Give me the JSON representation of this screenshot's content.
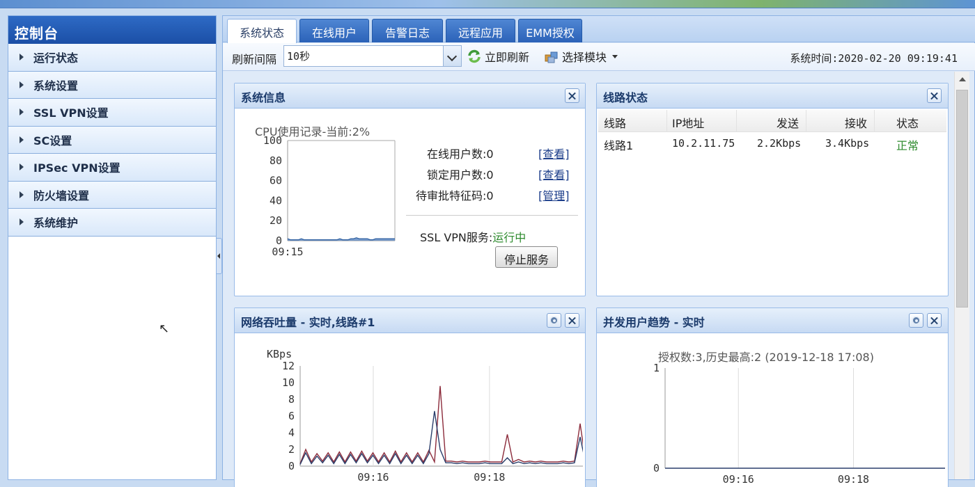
{
  "sidebar": {
    "title": "控制台",
    "items": [
      {
        "label": "运行状态"
      },
      {
        "label": "系统设置"
      },
      {
        "label": "SSL VPN设置"
      },
      {
        "label": "SC设置"
      },
      {
        "label": "IPSec VPN设置"
      },
      {
        "label": "防火墙设置"
      },
      {
        "label": "系统维护"
      }
    ]
  },
  "tabs": [
    {
      "label": "系统状态",
      "active": true
    },
    {
      "label": "在线用户"
    },
    {
      "label": "告警日志"
    },
    {
      "label": "远程应用"
    },
    {
      "label": "EMM授权"
    }
  ],
  "toolbar": {
    "interval_label": "刷新间隔",
    "interval_value": "10秒",
    "refresh_label": "立即刷新",
    "module_label": "选择模块",
    "system_time": "系统时间:2020-02-20 09:19:41"
  },
  "system_info": {
    "title": "系统信息",
    "cpu_title": "CPU使用记录-当前:2%",
    "online_users": "在线用户数:0",
    "online_link": "[查看]",
    "locked_users": "锁定用户数:0",
    "locked_link": "[查看]",
    "pending_codes": "待审批特征码:0",
    "pending_link": "[管理]",
    "service_label": "SSL VPN服务:",
    "service_status": "运行中",
    "stop_button": "停止服务"
  },
  "line_status": {
    "title": "线路状态",
    "headers": [
      "线路",
      "IP地址",
      "发送",
      "接收",
      "状态"
    ],
    "rows": [
      {
        "line": "线路1",
        "ip": "10.2.11.75",
        "send": "2.2Kbps",
        "recv": "3.4Kbps",
        "status": "正常"
      }
    ]
  },
  "throughput": {
    "title": "网络吞吐量 - 实时,线路#1"
  },
  "concurrent": {
    "title": "并发用户趋势 - 实时",
    "subtitle": "授权数:3,历史最高:2 (2019-12-18 17:08)"
  },
  "chart_data": [
    {
      "type": "area",
      "title": "CPU使用记录-当前:2%",
      "ylim": [
        0,
        100
      ],
      "yticks": [
        "100",
        "80",
        "60",
        "40",
        "20",
        "0"
      ],
      "xticks": [
        "09:15"
      ],
      "series": [
        {
          "values": [
            2,
            1,
            1,
            1,
            1,
            2,
            1,
            1,
            1,
            1,
            1,
            1,
            1,
            1,
            1,
            1,
            1,
            1,
            1,
            2,
            1,
            1,
            1,
            2,
            2,
            3,
            2,
            2,
            2,
            2,
            1,
            1,
            2,
            2,
            2,
            2,
            2,
            2,
            2,
            2
          ]
        }
      ],
      "colors": {
        "line": "#2f5f9f",
        "fill": "#5a86c2"
      }
    },
    {
      "type": "line",
      "ylabel": "KBps",
      "ylim": [
        0,
        12
      ],
      "yticks": [
        "12",
        "10",
        "8",
        "6",
        "4",
        "2",
        "0"
      ],
      "xticks": [
        "09:16",
        "09:18"
      ],
      "series": [
        {
          "values": [
            0.3,
            2.0,
            0.5,
            1.5,
            0.6,
            1.6,
            0.5,
            1.7,
            0.5,
            1.7,
            0.6,
            1.8,
            0.6,
            1.6,
            0.5,
            1.6,
            0.5,
            1.8,
            0.5,
            1.6,
            0.5,
            1.6,
            0.5,
            1.9,
            0.5,
            9.6,
            0.6,
            0.6,
            0.5,
            0.6,
            0.5,
            0.5,
            0.5,
            0.6,
            0.5,
            0.5,
            0.5,
            3.8,
            0.5,
            0.8,
            0.5,
            0.6,
            0.5,
            0.6,
            0.5,
            0.5,
            0.5,
            0.6,
            0.5,
            0.6,
            5.1,
            0.5
          ]
        },
        {
          "values": [
            0.2,
            1.6,
            0.3,
            1.2,
            0.4,
            1.3,
            0.3,
            1.4,
            0.3,
            1.4,
            0.4,
            1.5,
            0.4,
            1.3,
            0.3,
            1.3,
            0.3,
            1.5,
            0.3,
            1.3,
            0.3,
            1.3,
            0.3,
            1.5,
            6.6,
            2.0,
            0.4,
            0.4,
            0.3,
            0.4,
            0.3,
            0.3,
            0.3,
            0.4,
            0.3,
            0.3,
            0.3,
            1.0,
            0.3,
            0.5,
            0.3,
            0.4,
            0.3,
            0.4,
            0.3,
            0.3,
            0.3,
            0.4,
            0.3,
            0.4,
            3.5,
            0.3
          ]
        }
      ],
      "colors": {
        "series1": "#8b2a3a",
        "series2": "#2a3e6b"
      }
    },
    {
      "type": "line",
      "ylim": [
        0,
        1
      ],
      "yticks": [
        "1",
        "0"
      ],
      "xticks": [
        "09:16",
        "09:18"
      ],
      "series": [
        {
          "values": [
            0,
            0,
            0,
            0,
            0,
            0,
            0,
            0,
            0,
            0
          ]
        }
      ],
      "colors": {
        "line": "#2a3e6b"
      }
    }
  ]
}
